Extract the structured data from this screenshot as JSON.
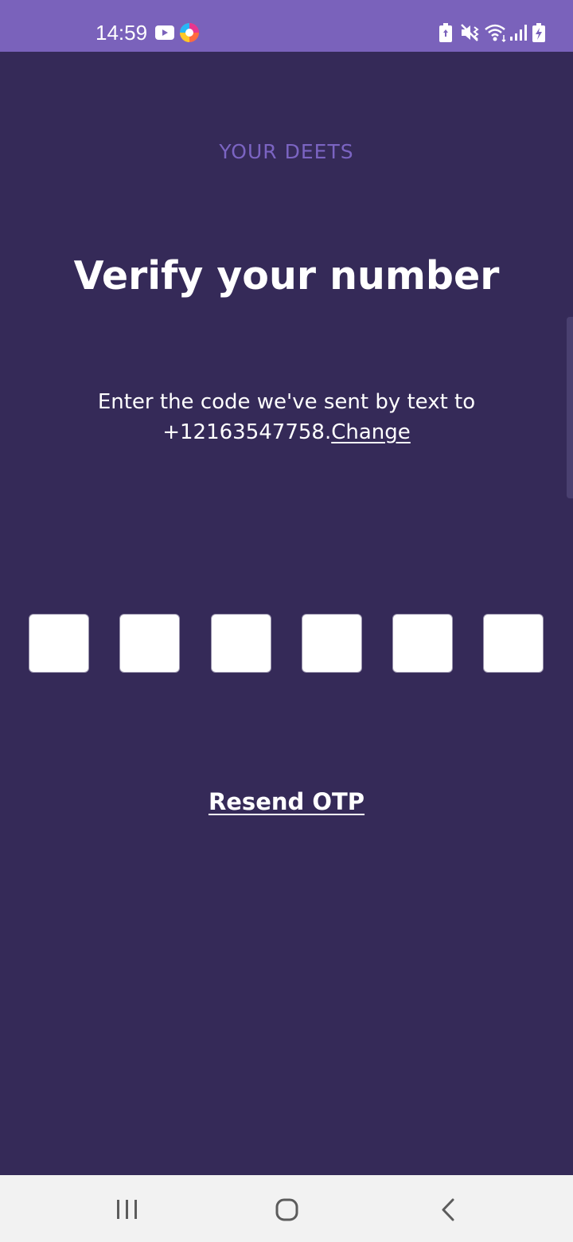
{
  "status_bar": {
    "time": "14:59",
    "background": "#7a62bb",
    "icons": [
      "youtube-notification-icon",
      "browser-notification-icon",
      "battery-saver-icon",
      "mute-vibrate-icon",
      "wifi-icon",
      "signal-icon",
      "battery-charging-icon"
    ]
  },
  "page": {
    "background": "#352a58",
    "eyebrow": "YOUR DEETS",
    "eyebrow_color": "#7b64c2",
    "title": "Verify your number",
    "instruction_line1": "Enter the code we've sent by text to",
    "phone_number": "+12163547758.",
    "change_link": "Change",
    "otp_digits": [
      "",
      "",
      "",
      "",
      "",
      ""
    ],
    "resend_label": "Resend OTP"
  },
  "nav_bar": {
    "background": "#f2f2f2",
    "buttons": [
      "recent-apps-icon",
      "home-icon",
      "back-icon"
    ]
  }
}
